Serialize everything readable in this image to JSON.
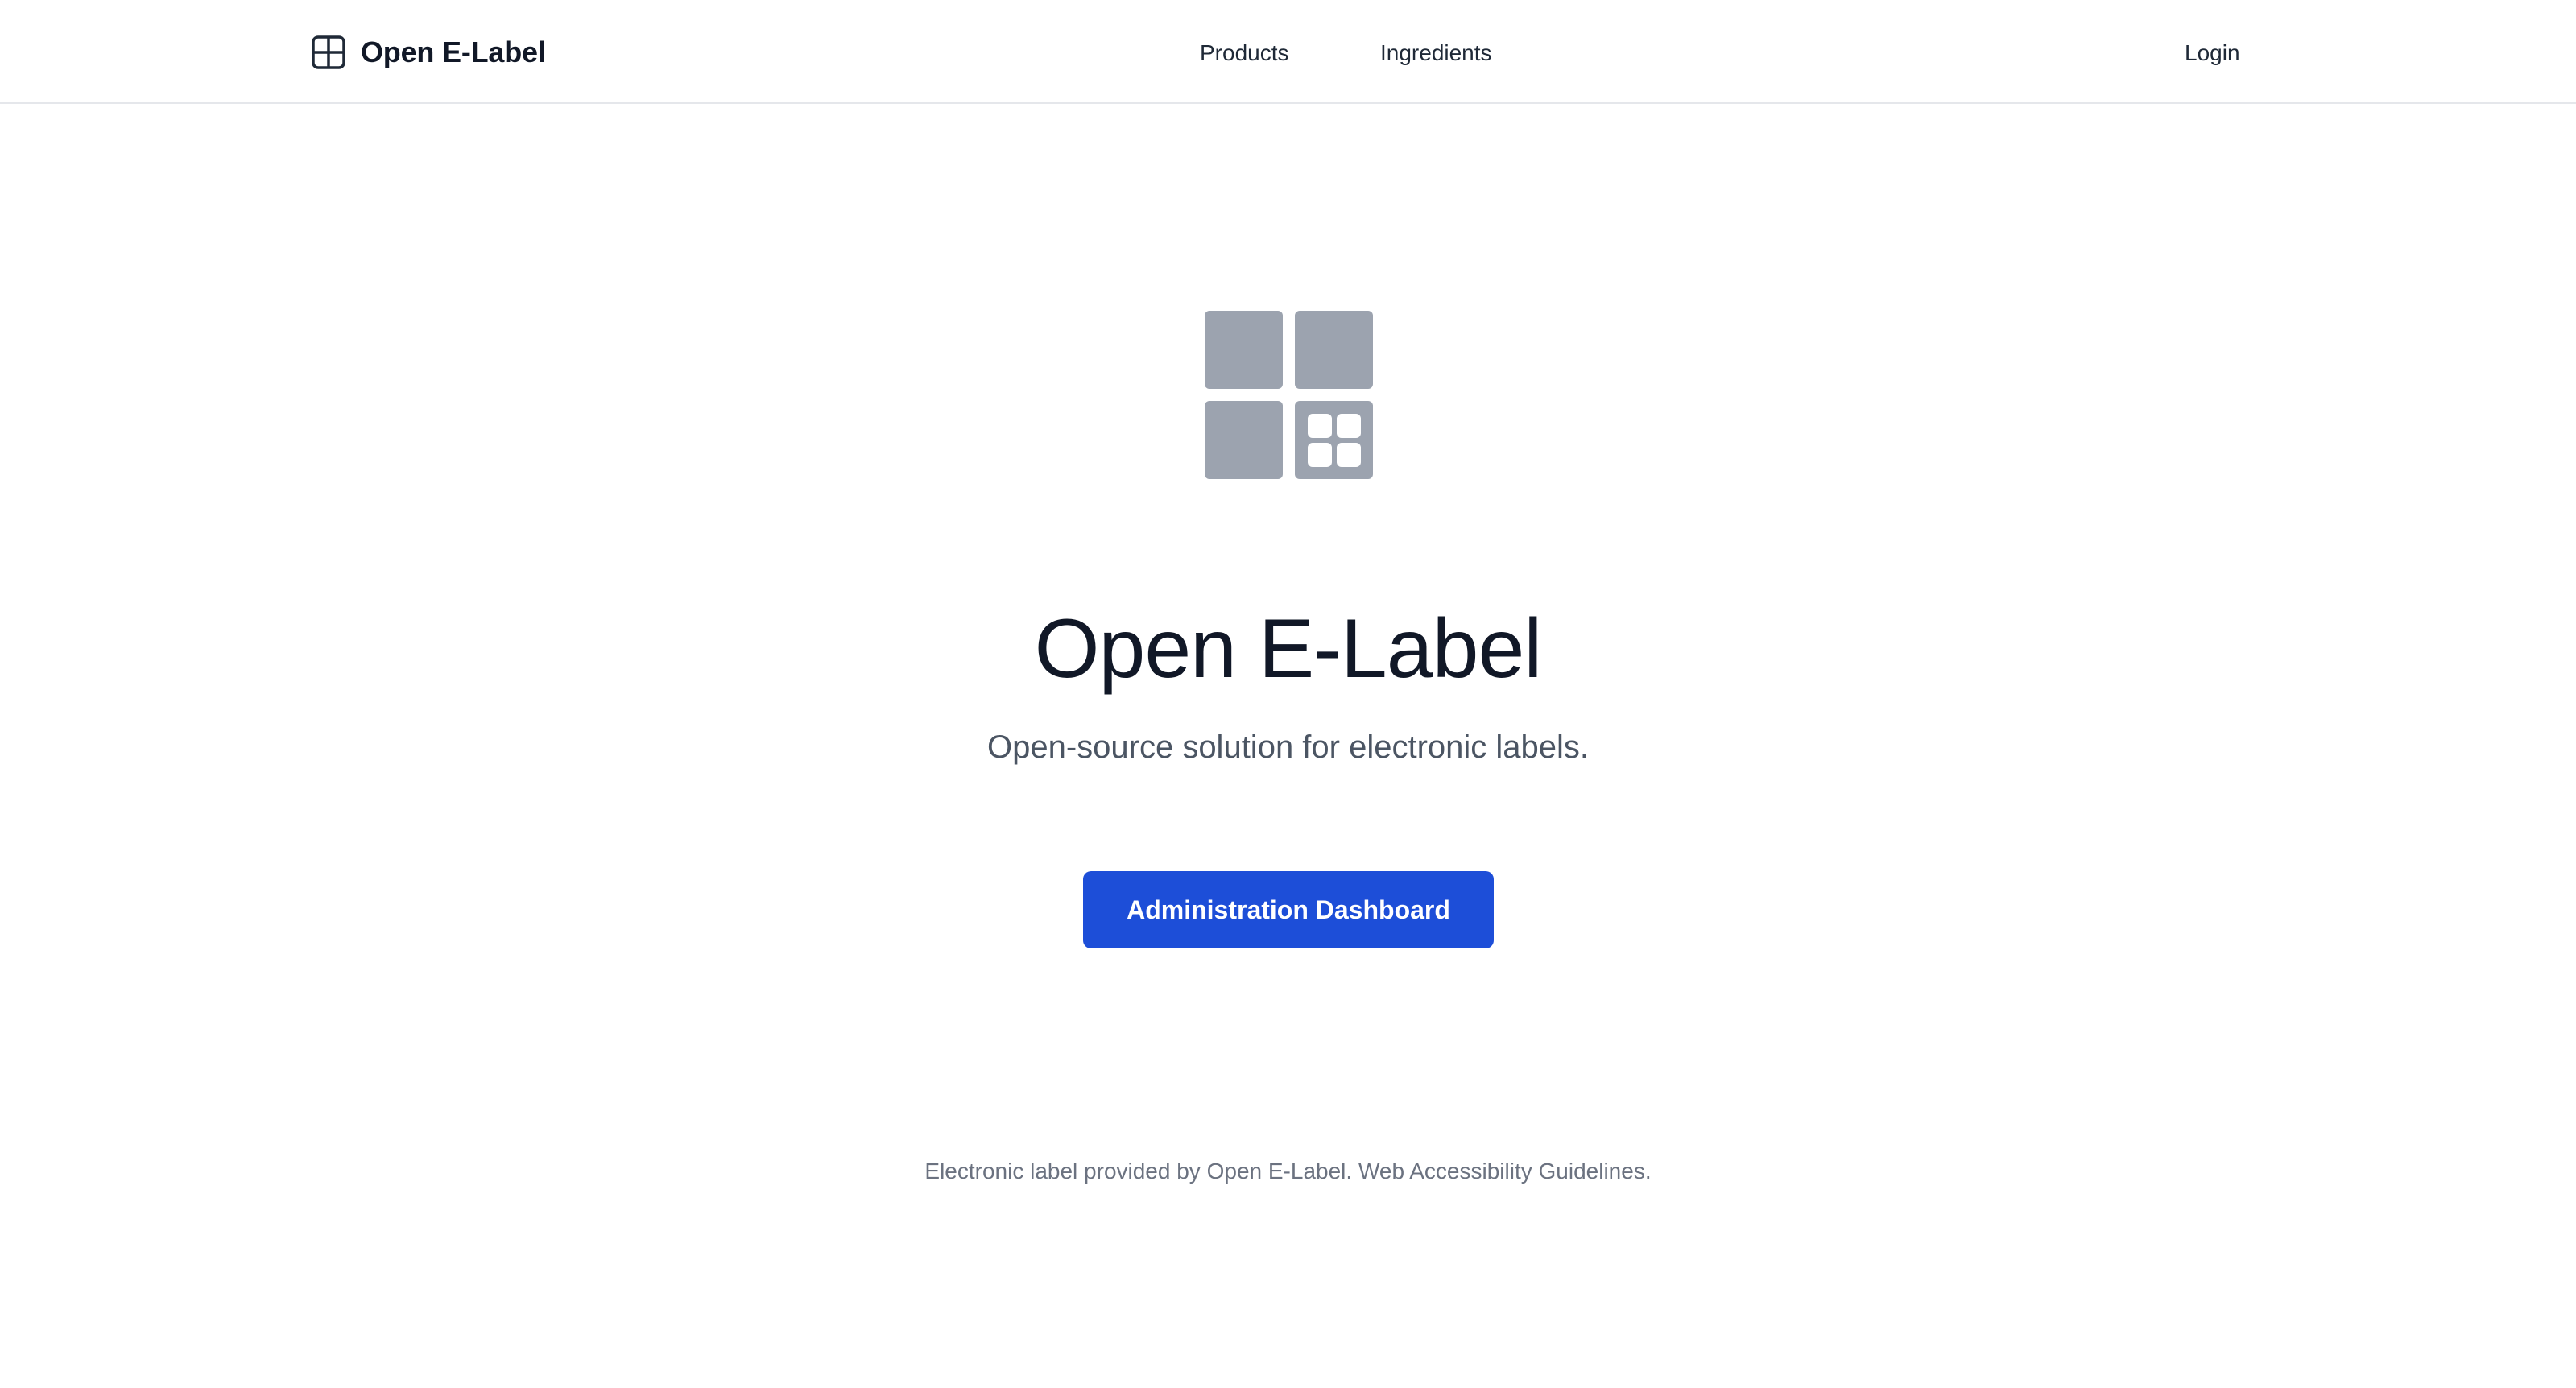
{
  "header": {
    "brand_label": "Open E-Label",
    "brand_icon": "grid-layout-icon",
    "nav": {
      "products": "Products",
      "ingredients": "Ingredients",
      "login": "Login"
    }
  },
  "hero": {
    "logo_icon": "e-label-logo-icon",
    "title": "Open E-Label",
    "subtitle": "Open-source solution for electronic labels.",
    "cta_label": "Administration Dashboard"
  },
  "footer": {
    "text_prefix": "Electronic label provided by ",
    "brand_link": "Open E-Label",
    "separator": ". ",
    "accessibility_link": "Web Accessibility Guidelines",
    "text_suffix": "."
  },
  "colors": {
    "primary": "#1d4ed8",
    "logo_gray": "#9ca3af",
    "text_dark": "#111827",
    "text_muted": "#6b7280",
    "border": "#e5e7eb"
  }
}
